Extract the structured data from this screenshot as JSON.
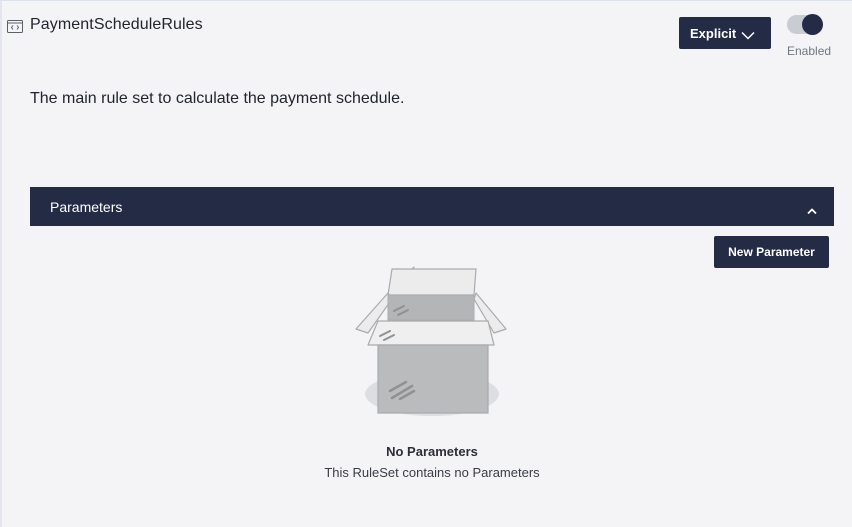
{
  "header": {
    "title": "PaymentScheduleRules",
    "icon": "ruleset-icon"
  },
  "mode_select": {
    "value": "Explicit"
  },
  "status_toggle": {
    "label": "Enabled",
    "on": true
  },
  "description": "The main rule set to calculate the payment schedule.",
  "parameters_section": {
    "title": "Parameters",
    "expanded": true,
    "new_button_label": "New Parameter",
    "empty_state": {
      "title": "No Parameters",
      "subtitle": "This RuleSet contains no Parameters",
      "icon": "empty-box-icon"
    }
  },
  "colors": {
    "primary": "#232b45",
    "background": "#f4f4f7"
  }
}
